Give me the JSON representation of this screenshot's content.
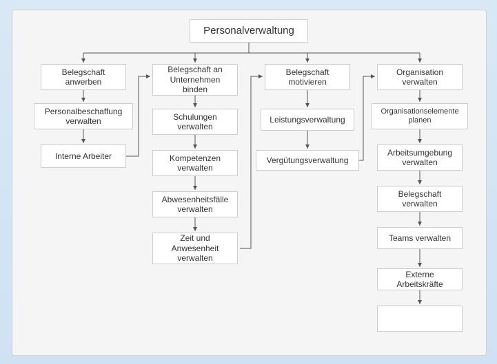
{
  "diagram": {
    "title": "Personalverwaltung",
    "root": "Personalverwaltung",
    "columns": {
      "col1": {
        "head": "Belegschaft anwerben",
        "items": [
          "Personalbeschaffung verwalten",
          "Interne Arbeiter"
        ]
      },
      "col2": {
        "head": "Belegschaft an Unternehmen binden",
        "items": [
          "Schulungen verwalten",
          "Kompetenzen verwalten",
          "Abwesenheitsfälle verwalten",
          "Zeit und Anwesenheit verwalten"
        ]
      },
      "col3": {
        "head": "Belegschaft motivieren",
        "items": [
          "Leistungsverwaltung",
          "Vergütungsverwaltung"
        ]
      },
      "col4": {
        "head": "Organisation verwalten",
        "items": [
          "Organisationselemente planen",
          "Arbeitsumgebung verwalten",
          "Belegschaft verwalten",
          "Teams verwalten",
          "Externe Arbeitskräfte"
        ]
      }
    }
  }
}
